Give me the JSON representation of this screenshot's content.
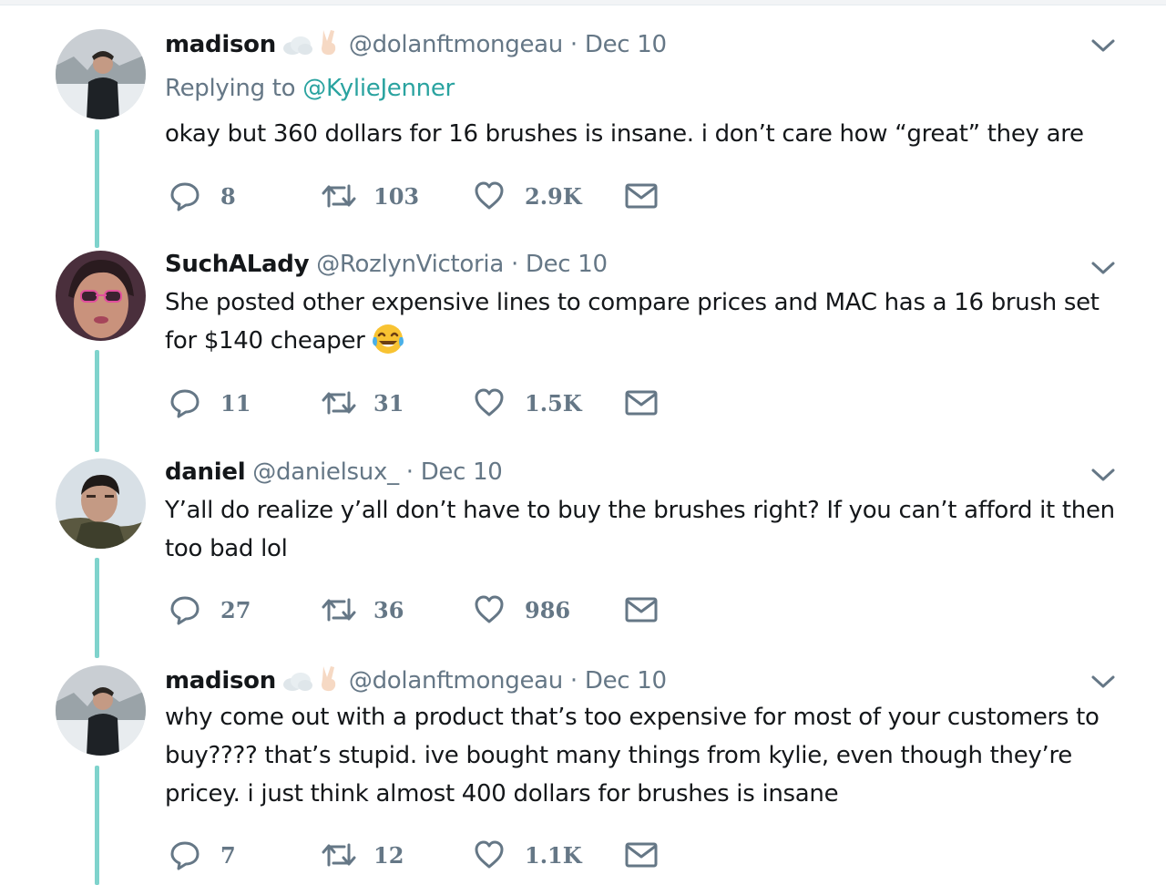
{
  "tweets": [
    {
      "name": "madison",
      "handle": "@dolanftmongeau",
      "dot": "·",
      "date": "Dec 10",
      "name_emojis": [
        "cloud-emoji",
        "victory-hand-emoji"
      ],
      "replying_label": "Replying to ",
      "replying_handle": "@KylieJenner",
      "text": "okay but 360 dollars for 16 brushes is insane. i don’t care how “great” they are",
      "replies": "8",
      "retweets": "103",
      "likes": "2.9K"
    },
    {
      "name": "SuchALady",
      "handle": "@RozlynVictoria",
      "dot": "·",
      "date": "Dec 10",
      "text": "She posted other expensive lines to compare prices and MAC has a 16 brush set for $140 cheaper",
      "text_emoji": "face-with-tears-of-joy-emoji",
      "replies": "11",
      "retweets": "31",
      "likes": "1.5K"
    },
    {
      "name": "daniel",
      "handle": "@danielsux_",
      "dot": "·",
      "date": "Dec 10",
      "text": "Y’all do realize y’all don’t have to buy the brushes right? If you can’t afford it then too bad lol",
      "replies": "27",
      "retweets": "36",
      "likes": "986"
    },
    {
      "name": "madison",
      "handle": "@dolanftmongeau",
      "dot": "·",
      "date": "Dec 10",
      "name_emojis": [
        "cloud-emoji",
        "victory-hand-emoji"
      ],
      "text": "why come out with a product that’s too expensive for most of your customers to buy???? that’s stupid. ive bought many things from kylie, even though they’re pricey. i just think almost 400 dollars for brushes is insane",
      "replies": "7",
      "retweets": "12",
      "likes": "1.1K"
    }
  ],
  "colors": {
    "thread_line": "#7fd3cc",
    "link": "#2aa3a0",
    "muted": "#657786",
    "text": "#14171a"
  }
}
